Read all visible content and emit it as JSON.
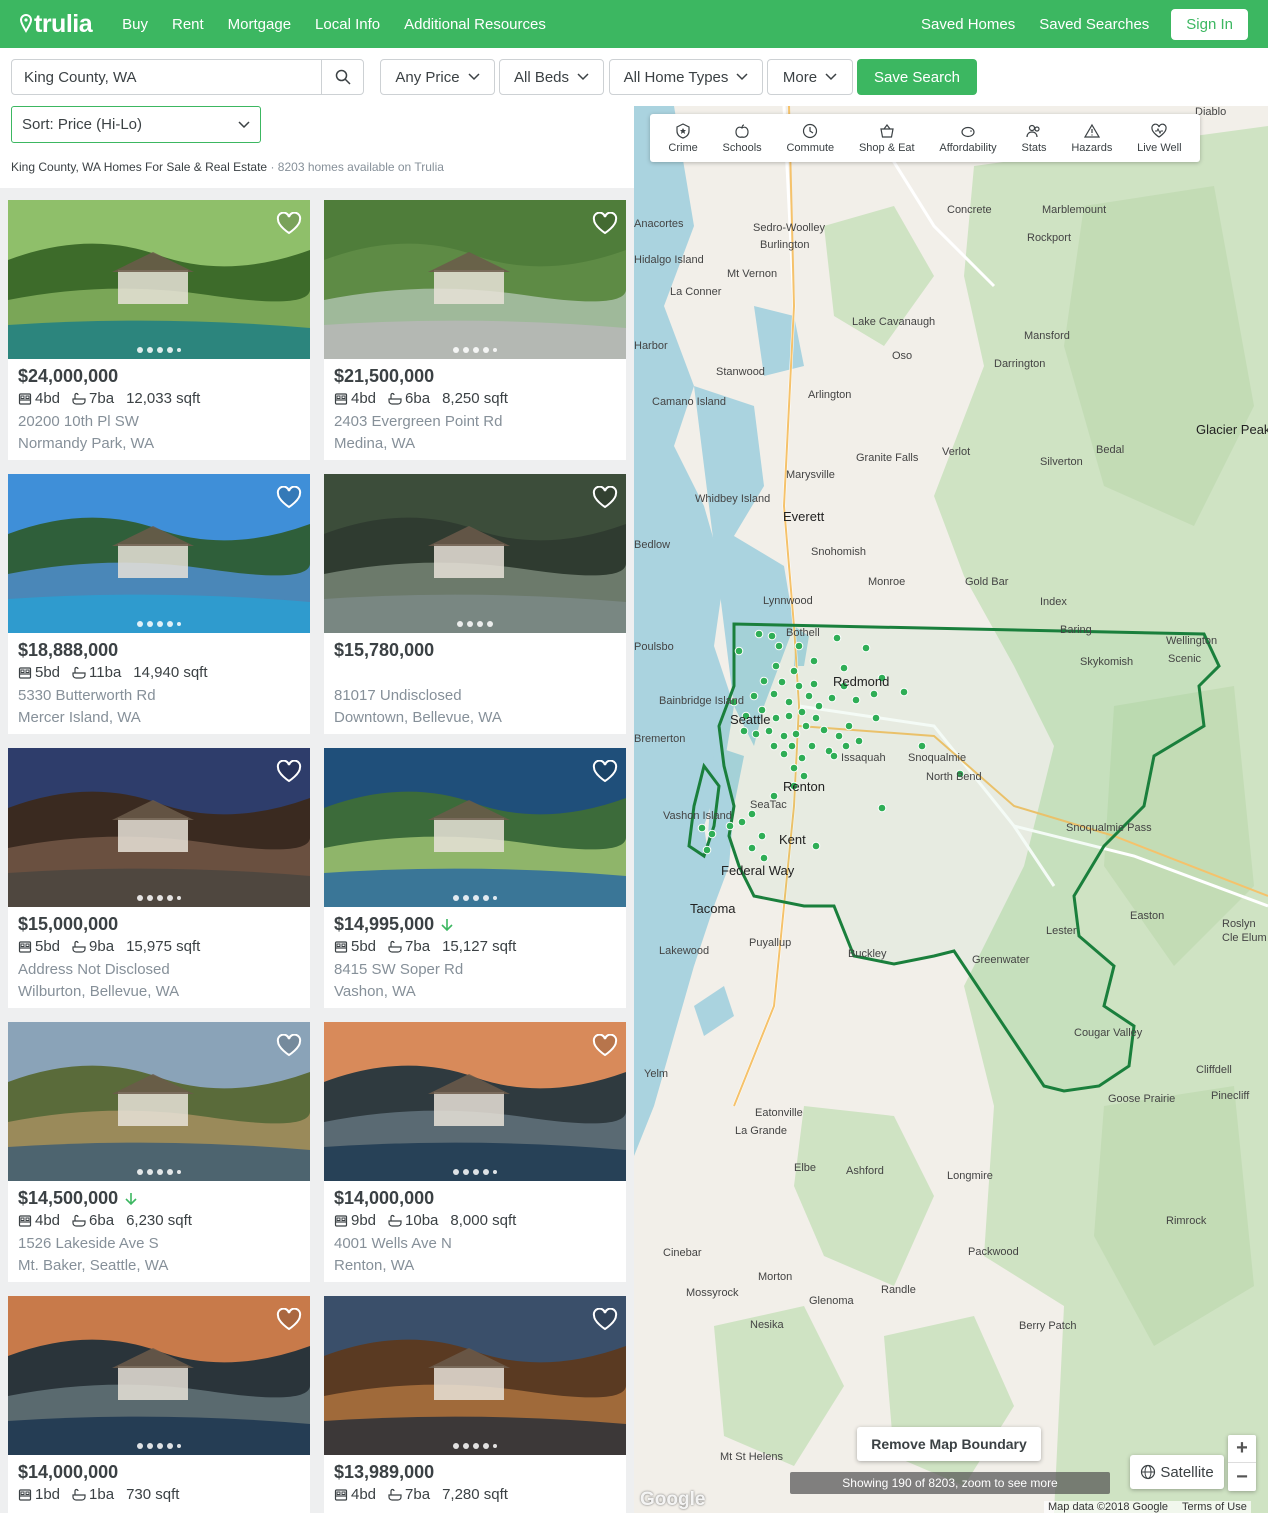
{
  "header": {
    "logo": "trulia",
    "nav": [
      "Buy",
      "Rent",
      "Mortgage",
      "Local Info",
      "Additional Resources"
    ],
    "saved_homes": "Saved Homes",
    "saved_searches": "Saved Searches",
    "sign_in": "Sign In"
  },
  "filters": {
    "search_value": "King County, WA",
    "price": "Any Price",
    "beds": "All Beds",
    "home_types": "All Home Types",
    "more": "More",
    "save_search": "Save Search",
    "sort": "Sort: Price (Hi-Lo)"
  },
  "results": {
    "title": "King County, WA Homes For Sale & Real Estate",
    "count": "8203 homes available on Trulia"
  },
  "listings": [
    {
      "price": "$24,000,000",
      "beds": "4bd",
      "baths": "7ba",
      "sqft": "12,033 sqft",
      "address": "20200 10th Pl SW",
      "city": "Normandy Park, WA",
      "price_drop": false
    },
    {
      "price": "$21,500,000",
      "beds": "4bd",
      "baths": "6ba",
      "sqft": "8,250 sqft",
      "address": "2403 Evergreen Point Rd",
      "city": "Medina, WA",
      "price_drop": false
    },
    {
      "price": "$18,888,000",
      "beds": "5bd",
      "baths": "11ba",
      "sqft": "14,940 sqft",
      "address": "5330 Butterworth Rd",
      "city": "Mercer Island, WA",
      "price_drop": false
    },
    {
      "price": "$15,780,000",
      "beds": "",
      "baths": "",
      "sqft": "",
      "address": "81017 Undisclosed",
      "city": "Downtown, Bellevue, WA",
      "price_drop": false
    },
    {
      "price": "$15,000,000",
      "beds": "5bd",
      "baths": "9ba",
      "sqft": "15,975 sqft",
      "address": "Address Not Disclosed",
      "city": "Wilburton, Bellevue, WA",
      "price_drop": false
    },
    {
      "price": "$14,995,000",
      "beds": "5bd",
      "baths": "7ba",
      "sqft": "15,127 sqft",
      "address": "8415 SW Soper Rd",
      "city": "Vashon, WA",
      "price_drop": true
    },
    {
      "price": "$14,500,000",
      "beds": "4bd",
      "baths": "6ba",
      "sqft": "6,230 sqft",
      "address": "1526 Lakeside Ave S",
      "city": "Mt. Baker, Seattle, WA",
      "price_drop": true
    },
    {
      "price": "$14,000,000",
      "beds": "9bd",
      "baths": "10ba",
      "sqft": "8,000 sqft",
      "address": "4001 Wells Ave N",
      "city": "Renton, WA",
      "price_drop": false
    },
    {
      "price": "$14,000,000",
      "beds": "1bd",
      "baths": "1ba",
      "sqft": "730 sqft",
      "address": "",
      "city": "",
      "price_drop": false
    },
    {
      "price": "$13,989,000",
      "beds": "4bd",
      "baths": "7ba",
      "sqft": "7,280 sqft",
      "address": "",
      "city": "",
      "price_drop": false
    }
  ],
  "map": {
    "tools": [
      "Crime",
      "Schools",
      "Commute",
      "Shop & Eat",
      "Affordability",
      "Stats",
      "Hazards",
      "Live Well"
    ],
    "places": [
      "Concrete",
      "Marblemount",
      "Rockport",
      "Sedro-Woolley",
      "Burlington",
      "Anacortes",
      "Hidalgo Island",
      "Mt Vernon",
      "La Conner",
      "Lake Cavanaugh",
      "Mansford",
      "Oso",
      "Darrington",
      "Harbor",
      "Stanwood",
      "Arlington",
      "Camano Island",
      "Glacier Peak",
      "Bedal",
      "Verlot",
      "Silverton",
      "Granite Falls",
      "Marysville",
      "Whidbey Island",
      "Everett",
      "Snohomish",
      "Monroe",
      "Gold Bar",
      "Index",
      "Baring",
      "Skykomish",
      "Wellington",
      "Scenic",
      "Lynnwood",
      "Bothell",
      "Redmond",
      "Bainbridge Island",
      "Seattle",
      "Bremerton",
      "Issaquah",
      "Snoqualmie",
      "North Bend",
      "Renton",
      "SeaTac",
      "Vashon Island",
      "Kent",
      "Federal Way",
      "Snoqualmie Pass",
      "Tacoma",
      "Easton",
      "Roslyn",
      "Cle Elum",
      "Lester",
      "Puyallup",
      "Lakewood",
      "Buckley",
      "Greenwater",
      "Cougar Valley",
      "Yelm",
      "Cliffdell",
      "Goose Prairie",
      "Pinecliff",
      "Eatonville",
      "La Grande",
      "Elbe",
      "Ashford",
      "Longmire",
      "Rimrock",
      "Cinebar",
      "Packwood",
      "Morton",
      "Mossyrock",
      "Randle",
      "Glenoma",
      "Nesika",
      "Berry Patch",
      "Mt St Helens",
      "Diablo",
      "Poulsbo",
      "Bedlow"
    ],
    "remove_boundary": "Remove Map Boundary",
    "showing": "Showing 190 of 8203, zoom to see more",
    "satellite": "Satellite",
    "zoom_in": "+",
    "zoom_out": "−",
    "google": "Google",
    "map_data": "Map data ©2018 Google",
    "terms": "Terms of Use",
    "colors": {
      "brand": "#3cb761",
      "boundary": "#1a7f3c",
      "marker": "#2fae56",
      "forest": "#cfe3c3",
      "water": "#aad3df"
    }
  }
}
